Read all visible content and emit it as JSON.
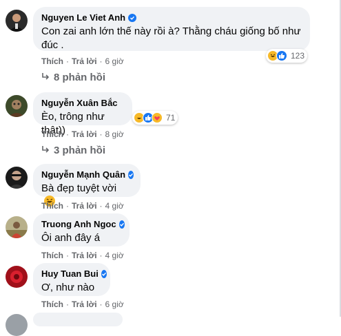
{
  "colors": {
    "bubble": "#f0f2f5",
    "verified": "#1877f2",
    "muted": "#65676b",
    "haha": "#f7b928",
    "like": "#1877f2",
    "love": "#f33e58"
  },
  "comments": [
    {
      "author": "Nguyen Le Viet Anh",
      "verified": true,
      "text_line1": "Con zai anh lớn thế này rồi à? Thằng cháu giống bố như",
      "text_line2": "đúc .",
      "like_label": "Thích",
      "reply_label": "Trả lời",
      "time": "6 giờ",
      "reactions": [
        "haha-icon",
        "like-icon"
      ],
      "reaction_count": "123",
      "replies_label": "8 phản hồi"
    },
    {
      "author": "Nguyễn Xuân Bắc",
      "verified": false,
      "text_line1": "Èo, trông như thật))",
      "like_label": "Thích",
      "reply_label": "Trả lời",
      "time": "8 giờ",
      "reactions": [
        "haha-icon",
        "like-icon",
        "care-icon"
      ],
      "reaction_count": "71",
      "replies_label": "3 phản hồi"
    },
    {
      "author": "Nguyễn Mạnh Quân",
      "verified": true,
      "text_line1": "Bà đẹp tuyệt vời",
      "emoji": "haha-icon",
      "like_label": "Thích",
      "reply_label": "Trả lời",
      "time": "4 giờ"
    },
    {
      "author": "Truong Anh Ngoc",
      "verified": true,
      "text_line1": "Ôi anh đây á",
      "like_label": "Thích",
      "reply_label": "Trả lời",
      "time": "4 giờ"
    },
    {
      "author": "Huy Tuan Bui",
      "verified": true,
      "text_line1": "Ơ, như nào",
      "like_label": "Thích",
      "reply_label": "Trả lời",
      "time": "6 giờ"
    }
  ]
}
